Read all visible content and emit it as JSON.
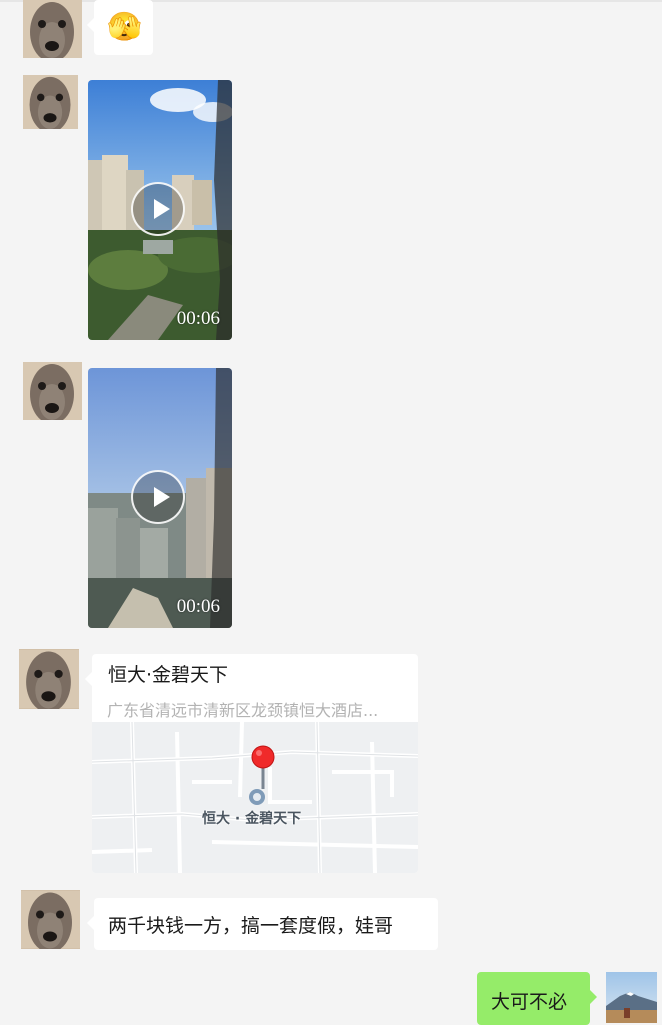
{
  "messages": [
    {
      "type": "emoji",
      "sender": "other",
      "emoji": "🫣"
    },
    {
      "type": "video",
      "sender": "other",
      "duration": "00:06"
    },
    {
      "type": "video",
      "sender": "other",
      "duration": "00:06"
    },
    {
      "type": "location",
      "sender": "other",
      "title": "恒大·金碧天下",
      "address": "广东省清远市清新区龙颈镇恒大酒店...",
      "map_label": "恒大 · 金碧天下"
    },
    {
      "type": "text",
      "sender": "other",
      "text": "两千块钱一方，搞一套度假，娃哥"
    },
    {
      "type": "text",
      "sender": "self",
      "text": "大可不必"
    }
  ],
  "colors": {
    "background": "#f4f4f4",
    "incoming_bubble": "#ffffff",
    "outgoing_bubble": "#95ec69",
    "map_pin": "#f02a2a"
  },
  "icons": {
    "play": "play-icon",
    "pin": "map-pin-icon"
  }
}
